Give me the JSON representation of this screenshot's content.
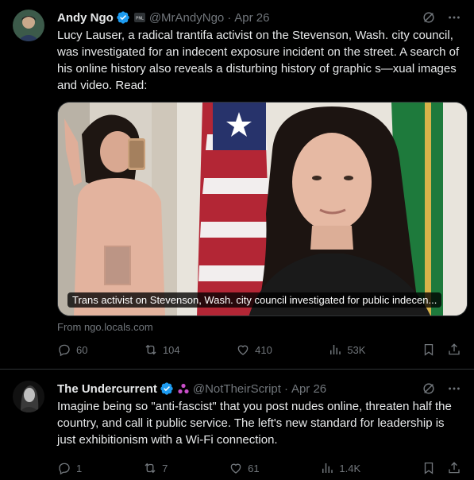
{
  "tweets": [
    {
      "name": "Andy Ngo",
      "handle": "@MrAndyNgo",
      "separator": "·",
      "date": "Apr 26",
      "text": "Lucy Lauser, a radical trantifa activist on the Stevenson, Wash. city council, was investigated for an indecent exposure incident on the street. A search of his online history also reveals a disturbing history of graphic s—xual images and video. Read:",
      "card": {
        "caption": "Trans activist on Stevenson, Wash. city council investigated for public indecen...",
        "source": "From ngo.locals.com"
      },
      "stats": {
        "replies": "60",
        "reposts": "104",
        "likes": "410",
        "views": "53K"
      }
    },
    {
      "name": "The Undercurrent",
      "handle": "@NotTheirScript",
      "separator": "·",
      "date": "Apr 26",
      "text": "Imagine being so \"anti-fascist\" that you post nudes online, threaten half the country, and call it public service. The left's new standard for leadership is just exhibitionism with a Wi-Fi connection.",
      "stats": {
        "replies": "1",
        "reposts": "7",
        "likes": "61",
        "views": "1.4K"
      }
    }
  ],
  "colors": {
    "background": "#000000",
    "text": "#e7e9ea",
    "muted": "#71767b",
    "verified": "#1d9bf0",
    "divider": "#2f3336",
    "affiliate": "#c94fc9"
  }
}
